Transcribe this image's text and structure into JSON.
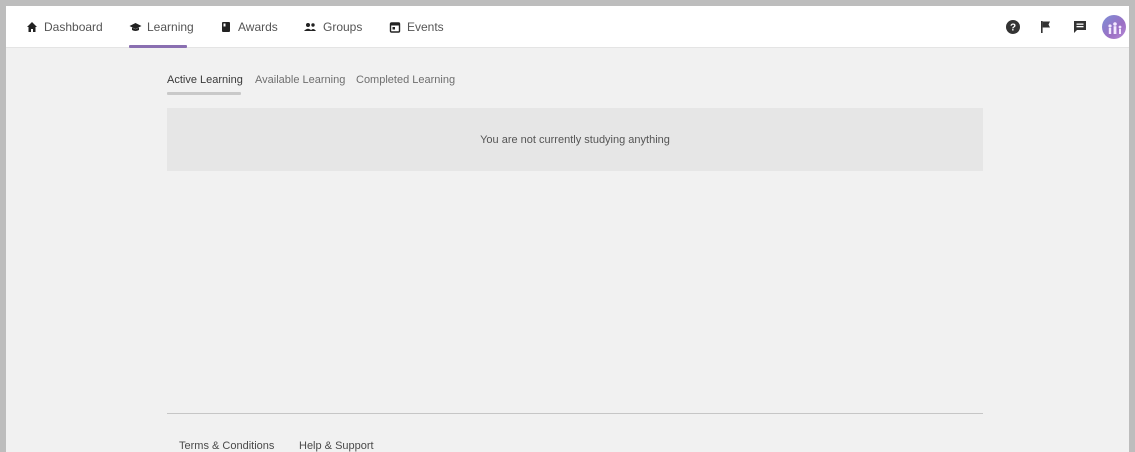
{
  "nav": {
    "items": [
      {
        "label": "Dashboard",
        "icon": "home-icon"
      },
      {
        "label": "Learning",
        "icon": "graduation-cap-icon"
      },
      {
        "label": "Awards",
        "icon": "book-icon"
      },
      {
        "label": "Groups",
        "icon": "people-icon"
      },
      {
        "label": "Events",
        "icon": "calendar-icon"
      }
    ],
    "active": "Learning",
    "accent_color": "#8a6fb1",
    "right_icons": [
      "help-icon",
      "flag-icon",
      "message-icon",
      "avatar"
    ]
  },
  "learning": {
    "tabs": [
      {
        "label": "Active Learning"
      },
      {
        "label": "Available Learning"
      },
      {
        "label": "Completed Learning"
      }
    ],
    "active_tab": "Active Learning",
    "empty_message": "You are not currently studying anything"
  },
  "footer": {
    "links": [
      {
        "label": "Terms & Conditions"
      },
      {
        "label": "Help & Support"
      }
    ]
  }
}
